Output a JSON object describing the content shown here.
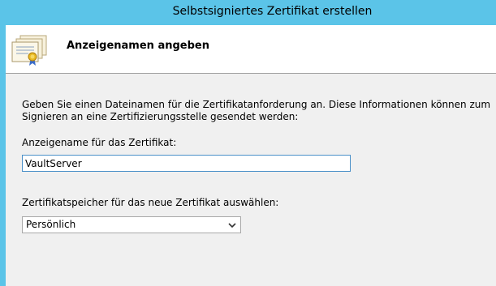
{
  "window": {
    "title": "Selbstsigniertes Zertifikat erstellen"
  },
  "header": {
    "heading": "Anzeigenamen angeben",
    "icon": "certificate-icon"
  },
  "main": {
    "description": "Geben Sie einen Dateinamen für die Zertifikatanforderung an. Diese Informationen können zum Signieren an eine Zertifizierungsstelle gesendet werden:",
    "name_label": "Anzeigename für das Zertifikat:",
    "name_value": "VaultServer",
    "store_label": "Zertifikatspeicher für das neue Zertifikat auswählen:",
    "store_value": "Persönlich"
  },
  "colors": {
    "titlebar": "#5bc4e8",
    "header_background": "#ffffff",
    "content_background": "#f0f0f0",
    "input_focus_border": "#4a90c8"
  }
}
